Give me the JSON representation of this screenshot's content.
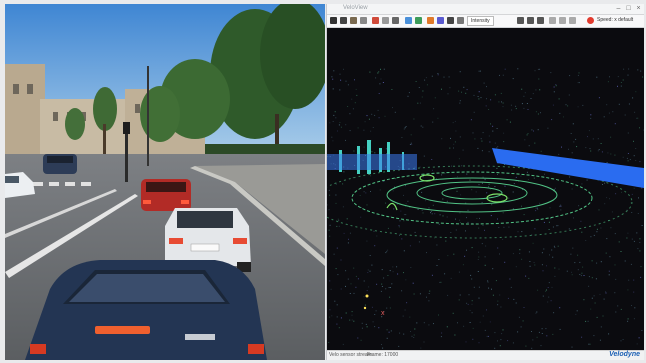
{
  "viewer": {
    "title": "VeloView",
    "toolbar_select": "Intensity",
    "toolbar_status": "Speed: x default"
  },
  "statusbar": {
    "left_text": "Velo sensor stream",
    "frame_text": "Frame: 17000",
    "brand": "Velodyne"
  },
  "colors": {
    "sky": "#6ea9dd",
    "road": "#6a6d70",
    "pointcloud_green": "#5ee39a",
    "pointcloud_blue": "#2a6cf0",
    "brand_blue": "#1a5fb4"
  }
}
